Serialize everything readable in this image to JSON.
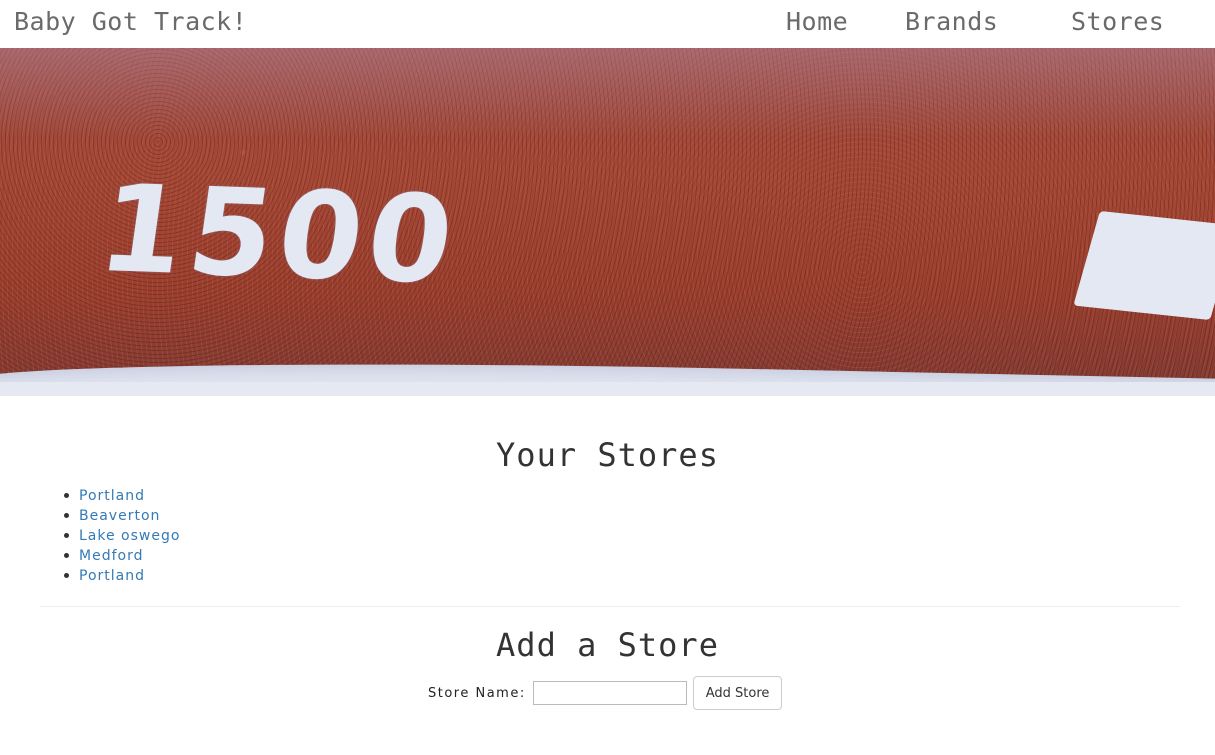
{
  "navbar": {
    "brand": "Baby Got Track!",
    "links": [
      {
        "label": "Home"
      },
      {
        "label": "Brands"
      },
      {
        "label": "Stores"
      }
    ]
  },
  "hero": {
    "number_text": "1500"
  },
  "stores_section": {
    "title": "Your Stores",
    "stores": [
      {
        "name": "Portland"
      },
      {
        "name": "Beaverton"
      },
      {
        "name": "Lake oswego"
      },
      {
        "name": "Medford"
      },
      {
        "name": "Portland"
      }
    ]
  },
  "add_section": {
    "title": "Add a Store",
    "label": "Store Name:",
    "input_value": "",
    "button_label": "Add Store"
  },
  "colors": {
    "link": "#337ab7",
    "nav_text": "#6a6a6a",
    "heading": "#333333",
    "track_red": "#a64836"
  }
}
